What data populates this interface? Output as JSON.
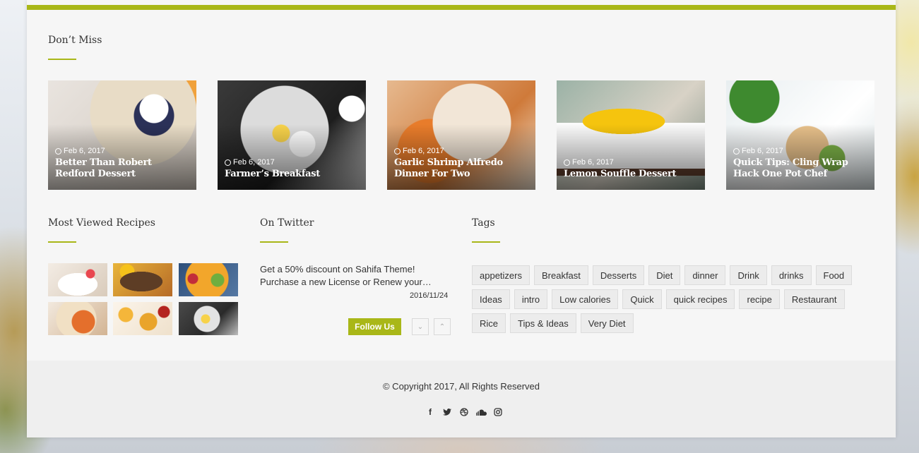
{
  "dont_miss": {
    "title": "Don’t Miss",
    "posts": [
      {
        "date": "Feb 6, 2017",
        "title": "Better Than Robert Redford Dessert"
      },
      {
        "date": "Feb 6, 2017",
        "title": "Farmer’s Breakfast"
      },
      {
        "date": "Feb 6, 2017",
        "title": "Garlic Shrimp Alfredo Dinner For Two"
      },
      {
        "date": "Feb 6, 2017",
        "title": "Lemon Souffle Dessert"
      },
      {
        "date": "Feb 6, 2017",
        "title": "Quick Tips: Cling Wrap Hack One Pot Chef"
      }
    ]
  },
  "most_viewed": {
    "title": "Most Viewed Recipes"
  },
  "twitter": {
    "title": "On Twitter",
    "tweet_text": "Get a 50% discount on Sahifa Theme! Purchase a new License or Renew your…",
    "tweet_date": "2016/11/24",
    "follow_label": "Follow Us",
    "prev_icon": "chevron-down-icon",
    "next_icon": "chevron-up-icon"
  },
  "tags": {
    "title": "Tags",
    "items": [
      "appetizers",
      "Breakfast",
      "Desserts",
      "Diet",
      "dinner",
      "Drink",
      "drinks",
      "Food",
      "Ideas",
      "intro",
      "Low calories",
      "Quick",
      "quick recipes",
      "recipe",
      "Restaurant",
      "Rice",
      "Tips & Ideas",
      "Very Diet"
    ]
  },
  "footer": {
    "copyright": "© Copyright 2017, All Rights Reserved",
    "social_icons": [
      "facebook-icon",
      "twitter-icon",
      "dribbble-icon",
      "soundcloud-icon",
      "instagram-icon"
    ]
  },
  "colors": {
    "accent": "#a9b718",
    "page_bg": "#f6f6f6",
    "footer_bg": "#efefef"
  }
}
